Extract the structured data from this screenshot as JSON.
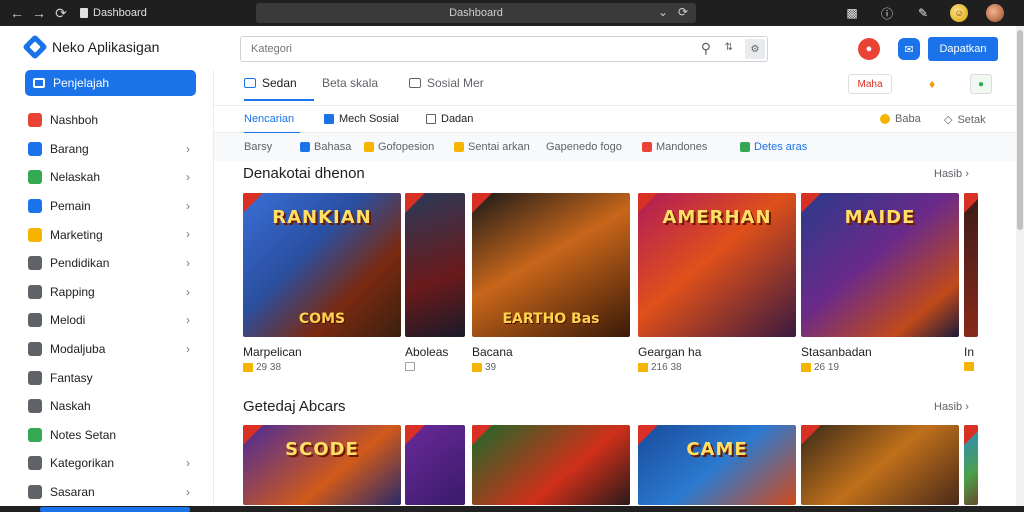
{
  "browser": {
    "tab_title": "Dashboard",
    "address": "Dashboard"
  },
  "app": {
    "title": "Neko Aplikasigan",
    "search_placeholder": "Kategori",
    "primary_button": "Dapatkan"
  },
  "sidebar": {
    "active_item": "Penjelajah",
    "items": [
      {
        "label": "Nashboh",
        "icon": "flag-icon",
        "color": "#ea4335",
        "chevron": false
      },
      {
        "label": "Barang",
        "icon": "cart-icon",
        "color": "#1a73e8",
        "chevron": true
      },
      {
        "label": "Nelaskah",
        "icon": "map-icon",
        "color": "#34a853",
        "chevron": true
      },
      {
        "label": "Pemain",
        "icon": "gamepad-icon",
        "color": "#1a73e8",
        "chevron": true
      },
      {
        "label": "Marketing",
        "icon": "folder-icon",
        "color": "#f5b400",
        "chevron": true
      },
      {
        "label": "Pendidikan",
        "icon": "education-icon",
        "color": "#5f6368",
        "chevron": true
      },
      {
        "label": "Rapping",
        "icon": "music-icon",
        "color": "#5f6368",
        "chevron": true
      },
      {
        "label": "Melodi",
        "icon": "bell-icon",
        "color": "#5f6368",
        "chevron": true
      },
      {
        "label": "Modaljuba",
        "icon": "calendar-icon",
        "color": "#5f6368",
        "chevron": true
      },
      {
        "label": "Fantasy",
        "icon": "search-icon",
        "color": "#5f6368",
        "chevron": false
      },
      {
        "label": "Naskah",
        "icon": "grid-icon",
        "color": "#5f6368",
        "chevron": false
      },
      {
        "label": "Notes Setan",
        "icon": "circle-icon",
        "color": "#34a853",
        "chevron": false
      },
      {
        "label": "Kategorikan",
        "icon": "tag-icon",
        "color": "#5f6368",
        "chevron": true
      },
      {
        "label": "Sasaran",
        "icon": "clock-icon",
        "color": "#5f6368",
        "chevron": true
      }
    ]
  },
  "main": {
    "tabs1": [
      {
        "label": "Sedan",
        "active": true
      },
      {
        "label": "Beta skala",
        "active": false
      },
      {
        "label": "Sosial Mer",
        "active": false
      }
    ],
    "tab_buttons": {
      "red": "Maha",
      "yellow": "♦",
      "green": "●"
    },
    "tabs2": [
      {
        "label": "Nencarian",
        "active": true
      },
      {
        "label": "Mech Sosial",
        "active": false
      },
      {
        "label": "Dadan",
        "active": false
      }
    ],
    "right_links": {
      "left": "Baba",
      "right": "Setak"
    },
    "filters": [
      {
        "label": "Barsy",
        "color": "",
        "link": false
      },
      {
        "label": "Bahasa",
        "color": "#1a73e8",
        "link": false
      },
      {
        "label": "Gofopesion",
        "color": "#f5b400",
        "link": false
      },
      {
        "label": "Sentai arkan",
        "color": "#f5b400",
        "link": false
      },
      {
        "label": "Gapenedo fogo",
        "color": "",
        "link": false
      },
      {
        "label": "Mandones",
        "color": "#ea4335",
        "link": false
      },
      {
        "label": "Detes aras",
        "color": "#34a853",
        "link": true
      }
    ],
    "section1": {
      "title": "Denakotai dhenon",
      "more": "Hasib",
      "cards": [
        {
          "title": "Marpelican",
          "meta": "29 38",
          "banner": "RANKIAN",
          "sub": "COMS",
          "bg": "linear-gradient(135deg,#3a6fd8 0%,#2a4fa0 40%,#7a2a10 70%,#3a2010 100%)"
        },
        {
          "title": "Aboleas",
          "meta": "",
          "banner": "",
          "sub": "",
          "bg": "linear-gradient(160deg,#2a3a5a 0%,#6a1a1a 60%,#1a1a2a 100%)"
        },
        {
          "title": "Bacana",
          "meta": "39",
          "banner": "",
          "sub": "EARTHO Bas",
          "bg": "linear-gradient(150deg,#1a1a1a 0%,#c8661a 45%,#3a1a08 100%)"
        },
        {
          "title": "Geargan ha",
          "meta": "216 38",
          "banner": "AMERHAN",
          "sub": "",
          "bg": "linear-gradient(140deg,#b01a5a 0%,#e0501a 45%,#3a1a40 100%)"
        },
        {
          "title": "Stasanbadan",
          "meta": "26 19",
          "banner": "MAIDE",
          "sub": "",
          "bg": "linear-gradient(140deg,#2a3a8a 0%,#6a2a8a 45%,#c04a1a 80%,#1a1a3a 100%)"
        },
        {
          "title": "In",
          "meta": "",
          "banner": "",
          "sub": "",
          "bg": "linear-gradient(160deg,#3a1a1a 0%,#8a2a1a 100%)"
        }
      ]
    },
    "section2": {
      "title": "Getedaj Abcars",
      "more": "Hasib",
      "cards": [
        {
          "title": "",
          "banner": "SCODE",
          "bg": "linear-gradient(140deg,#4a2a9a 0%,#d05a1a 60%,#2a2a6a 100%)"
        },
        {
          "title": "",
          "banner": "",
          "bg": "linear-gradient(140deg,#6a2a9a 0%,#3a1a6a 100%)"
        },
        {
          "title": "",
          "banner": "",
          "bg": "linear-gradient(140deg,#1a6a2a 0%,#d0301a 60%,#2a1a1a 100%)"
        },
        {
          "title": "",
          "banner": "CAME",
          "bg": "linear-gradient(140deg,#1a4a9a 0%,#2a7ad0 50%,#d04a1a 100%)"
        },
        {
          "title": "",
          "banner": "",
          "bg": "linear-gradient(140deg,#3a2a1a 0%,#c0701a 50%,#4a2a1a 100%)"
        },
        {
          "title": "",
          "banner": "",
          "bg": "linear-gradient(140deg,#2a8ad0 0%,#4aa04a 60%,#6a4a2a 100%)"
        }
      ]
    }
  }
}
